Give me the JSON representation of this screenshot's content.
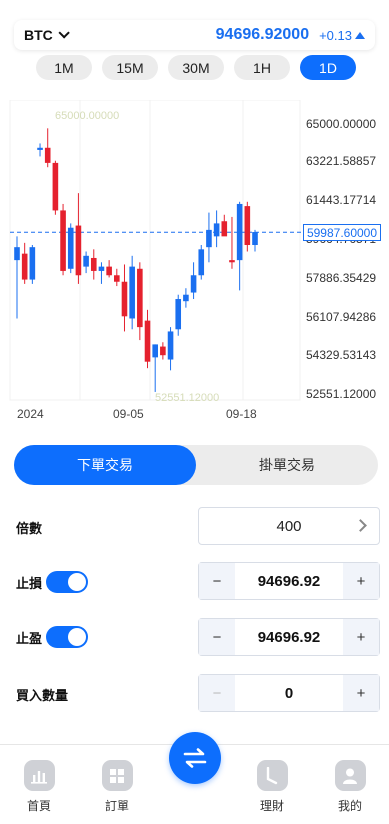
{
  "header": {
    "symbol": "BTC",
    "price": "94696.92000",
    "change": "+0.13",
    "change_direction_icon": "triangle-up-icon",
    "accent_color": "#1a6ff0"
  },
  "intervals": [
    "1M",
    "15M",
    "30M",
    "1H",
    "1D"
  ],
  "active_interval": "1D",
  "chart_data": {
    "type": "candlestick",
    "y_axis_labels": [
      "65000.00000",
      "63221.58857",
      "61443.17714",
      "59664.76571",
      "57886.35429",
      "56107.94286",
      "54329.53143",
      "52551.12000"
    ],
    "x_axis_labels": [
      "2024",
      "09-05",
      "09-18"
    ],
    "ylim": [
      52551.12,
      65000
    ],
    "last_price_label": "59987.60000",
    "watermark_high": "65000.00000",
    "watermark_low": "52551.12000",
    "up_color": "#1a6ff0",
    "down_color": "#e5212e",
    "candles": [
      {
        "o": 58700,
        "h": 59800,
        "l": 56000,
        "c": 59300
      },
      {
        "o": 59000,
        "h": 59500,
        "l": 57600,
        "c": 57800
      },
      {
        "o": 57800,
        "h": 59400,
        "l": 57600,
        "c": 59300
      },
      {
        "o": 63800,
        "h": 64100,
        "l": 63500,
        "c": 63900
      },
      {
        "o": 63900,
        "h": 64800,
        "l": 63000,
        "c": 63200
      },
      {
        "o": 63200,
        "h": 63300,
        "l": 60800,
        "c": 61000
      },
      {
        "o": 61000,
        "h": 61300,
        "l": 58000,
        "c": 58200
      },
      {
        "o": 58300,
        "h": 60400,
        "l": 58100,
        "c": 60200
      },
      {
        "o": 60300,
        "h": 61800,
        "l": 57600,
        "c": 58000
      },
      {
        "o": 58400,
        "h": 59100,
        "l": 58100,
        "c": 58900
      },
      {
        "o": 58800,
        "h": 59200,
        "l": 57800,
        "c": 58200
      },
      {
        "o": 58200,
        "h": 58600,
        "l": 57600,
        "c": 58400
      },
      {
        "o": 58400,
        "h": 58700,
        "l": 57900,
        "c": 58000
      },
      {
        "o": 58000,
        "h": 58300,
        "l": 57500,
        "c": 57700
      },
      {
        "o": 57700,
        "h": 58500,
        "l": 55400,
        "c": 56100
      },
      {
        "o": 56000,
        "h": 58900,
        "l": 55500,
        "c": 58400
      },
      {
        "o": 58300,
        "h": 58600,
        "l": 55000,
        "c": 55600
      },
      {
        "o": 55900,
        "h": 56400,
        "l": 53700,
        "c": 54000
      },
      {
        "o": 54200,
        "h": 54800,
        "l": 52600,
        "c": 54800
      },
      {
        "o": 54700,
        "h": 54900,
        "l": 54100,
        "c": 54300
      },
      {
        "o": 54100,
        "h": 55600,
        "l": 53600,
        "c": 55400
      },
      {
        "o": 55500,
        "h": 57100,
        "l": 55200,
        "c": 56900
      },
      {
        "o": 56800,
        "h": 57400,
        "l": 56500,
        "c": 57100
      },
      {
        "o": 57200,
        "h": 58600,
        "l": 56900,
        "c": 58000
      },
      {
        "o": 58000,
        "h": 59400,
        "l": 57800,
        "c": 59200
      },
      {
        "o": 59300,
        "h": 60900,
        "l": 58600,
        "c": 60100
      },
      {
        "o": 59800,
        "h": 61000,
        "l": 59300,
        "c": 60400
      },
      {
        "o": 60500,
        "h": 60800,
        "l": 59900,
        "c": 59800
      },
      {
        "o": 58700,
        "h": 60700,
        "l": 58300,
        "c": 58600
      },
      {
        "o": 58700,
        "h": 61400,
        "l": 57300,
        "c": 61300
      },
      {
        "o": 61200,
        "h": 61400,
        "l": 59100,
        "c": 59400
      },
      {
        "o": 59400,
        "h": 60100,
        "l": 59100,
        "c": 60000
      }
    ]
  },
  "trade_tabs": [
    "下單交易",
    "掛單交易"
  ],
  "active_trade_tab": "下單交易",
  "form": {
    "leverage_label": "倍數",
    "leverage_value": "400",
    "stop_loss_label": "止損",
    "stop_loss_enabled": true,
    "stop_loss_value": "94696.92",
    "take_profit_label": "止盈",
    "take_profit_enabled": true,
    "take_profit_value": "94696.92",
    "quantity_label": "買入數量",
    "quantity_value": "0",
    "minus": "−",
    "plus": "+"
  },
  "nav": {
    "items": [
      {
        "label": "首頁",
        "icon": "home-chart-icon"
      },
      {
        "label": "訂單",
        "icon": "orders-grid-icon"
      },
      {
        "label": "理財",
        "icon": "finance-clock-icon"
      },
      {
        "label": "我的",
        "icon": "profile-icon"
      }
    ],
    "center_icon": "swap-arrows-icon"
  }
}
